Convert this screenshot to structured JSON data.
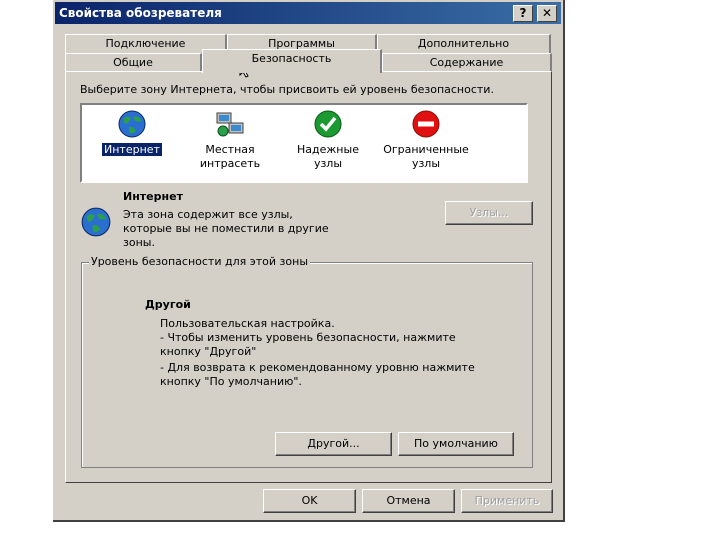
{
  "window": {
    "title": "Свойства обозревателя",
    "help_button": "?",
    "close_button": "✕"
  },
  "tabs_back": [
    "Подключение",
    "Программы",
    "Дополнительно"
  ],
  "tabs_front": [
    "Общие",
    "Безопасность",
    "Содержание"
  ],
  "active_tab": "Безопасность",
  "zone_prompt": "Выберите зону Интернета, чтобы присвоить ей уровень безопасности.",
  "zones": [
    {
      "line1": "Интернет",
      "line2": "",
      "icon": "globe-icon",
      "selected": true
    },
    {
      "line1": "Местная",
      "line2": "интрасеть",
      "icon": "local-intranet-icon",
      "selected": false
    },
    {
      "line1": "Надежные",
      "line2": "узлы",
      "icon": "check-icon",
      "selected": false
    },
    {
      "line1": "Ограниченные",
      "line2": "узлы",
      "icon": "no-entry-icon",
      "selected": false
    }
  ],
  "zone_info": {
    "name": "Интернет",
    "desc1": "Эта зона содержит все узлы,",
    "desc2": "которые вы не поместили в другие",
    "desc3": "зоны.",
    "sites_button": "Узлы..."
  },
  "security_level": {
    "group_label": "Уровень безопасности для этой зоны",
    "level_name": "Другой",
    "line1": "Пользовательская настройка.",
    "line2": "- Чтобы изменить уровень безопасности, нажмите",
    "line3": "кнопку \"Другой\"",
    "line4": "- Для возврата к рекомендованному уровню нажмите",
    "line5": "кнопку \"По умолчанию\".",
    "custom_button": "Другой...",
    "default_button": "По умолчанию"
  },
  "footer": {
    "ok": "OK",
    "cancel": "Отмена",
    "apply": "Применить"
  },
  "colors": {
    "titlebar": "#0a246a",
    "face": "#d4d0c8",
    "selection": "#0a246a"
  }
}
